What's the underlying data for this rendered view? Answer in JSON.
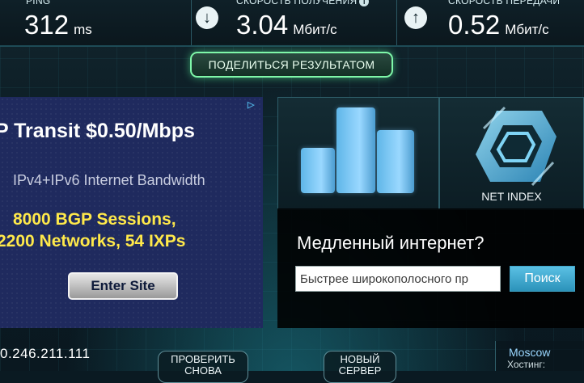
{
  "stats": {
    "ping": {
      "title": "PING",
      "value": "312",
      "unit": "ms"
    },
    "download": {
      "title": "СКОРОСТЬ ПОЛУЧЕНИЯ",
      "value": "3.04",
      "unit": "Мбит/с",
      "icon": "download-arrow-icon"
    },
    "upload": {
      "title": "СКОРОСТЬ ПЕРЕДАЧИ",
      "value": "0.52",
      "unit": "Мбит/с",
      "icon": "upload-arrow-icon"
    }
  },
  "share": {
    "label": "ПОДЕЛИТЬСЯ РЕЗУЛЬТАТОМ"
  },
  "ad": {
    "headline": "P Transit $0.50/Mbps",
    "subtitle": "IPv4+IPv6 Internet Bandwidth",
    "line1": "8000 BGP Sessions,",
    "line2": "2200 Networks, 54 IXPs",
    "button": "Enter Site"
  },
  "tiles": {
    "netindex_label": "NET INDEX"
  },
  "slow": {
    "title": "Медленный интернет?",
    "input_value": "Быстрее широкополосного пр",
    "button": "Поиск"
  },
  "bottom": {
    "ip": "0.246.211.111",
    "retest_label": "ПРОВЕРИТЬ СНОВА",
    "new_server_label": "НОВЫЙ СЕРВЕР",
    "city": "Moscow",
    "host_label": "Хостинг:"
  },
  "colors": {
    "accent_green": "#7ff7a9",
    "search_blue": "#3fa5c9",
    "ad_yellow": "#ffe94a"
  }
}
